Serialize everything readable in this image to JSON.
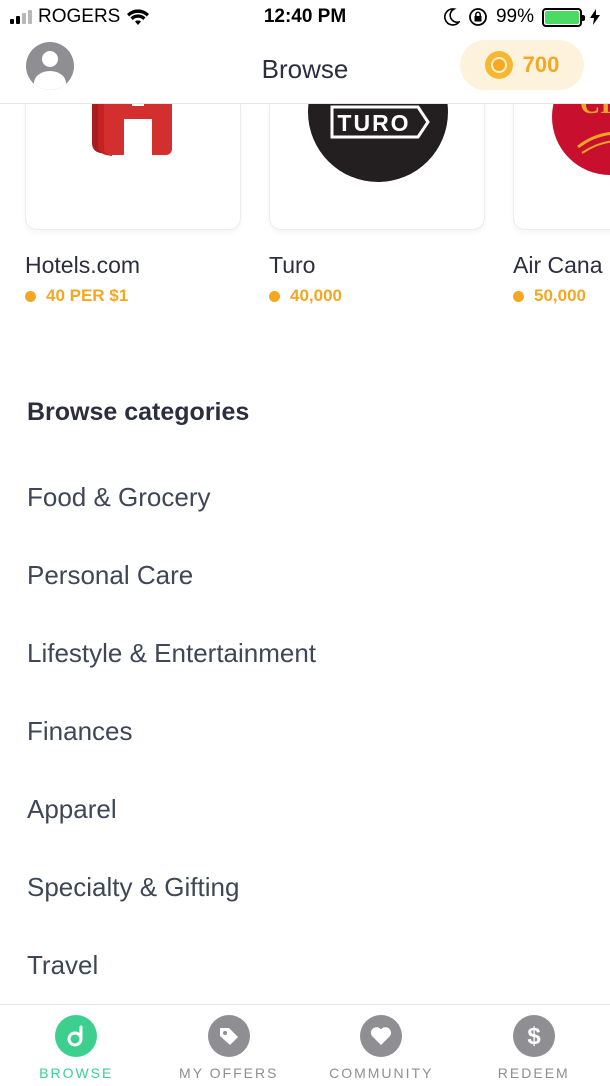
{
  "status_bar": {
    "carrier": "ROGERS",
    "time": "12:40 PM",
    "battery": "99%"
  },
  "header": {
    "title": "Browse",
    "points": "700"
  },
  "partners": [
    {
      "name": "Hotels.com",
      "points": "40 PER $1",
      "logo_icon": "hotels-logo-icon"
    },
    {
      "name": "Turo",
      "points": "40,000",
      "logo_text": "TURO",
      "logo_icon": "turo-logo-icon"
    },
    {
      "name": "Air Cana",
      "points": "50,000",
      "logo_text": "CI",
      "logo_icon": "air-canada-logo-icon"
    }
  ],
  "categories": {
    "title": "Browse categories",
    "items": [
      "Food & Grocery",
      "Personal Care",
      "Lifestyle & Entertainment",
      "Finances",
      "Apparel",
      "Specialty & Gifting",
      "Travel"
    ]
  },
  "tabs": [
    {
      "label": "BROWSE",
      "icon": "drop-logo-icon",
      "active": true
    },
    {
      "label": "MY OFFERS",
      "icon": "tag-icon",
      "active": false
    },
    {
      "label": "COMMUNITY",
      "icon": "heart-icon",
      "active": false
    },
    {
      "label": "REDEEM",
      "icon": "dollar-icon",
      "active": false
    }
  ],
  "colors": {
    "accent_green": "#3ccf8e",
    "points_gold": "#f5a623",
    "hotels_red": "#d32f2f",
    "turo_dark": "#231f20",
    "air_canada_red": "#c8102e"
  }
}
